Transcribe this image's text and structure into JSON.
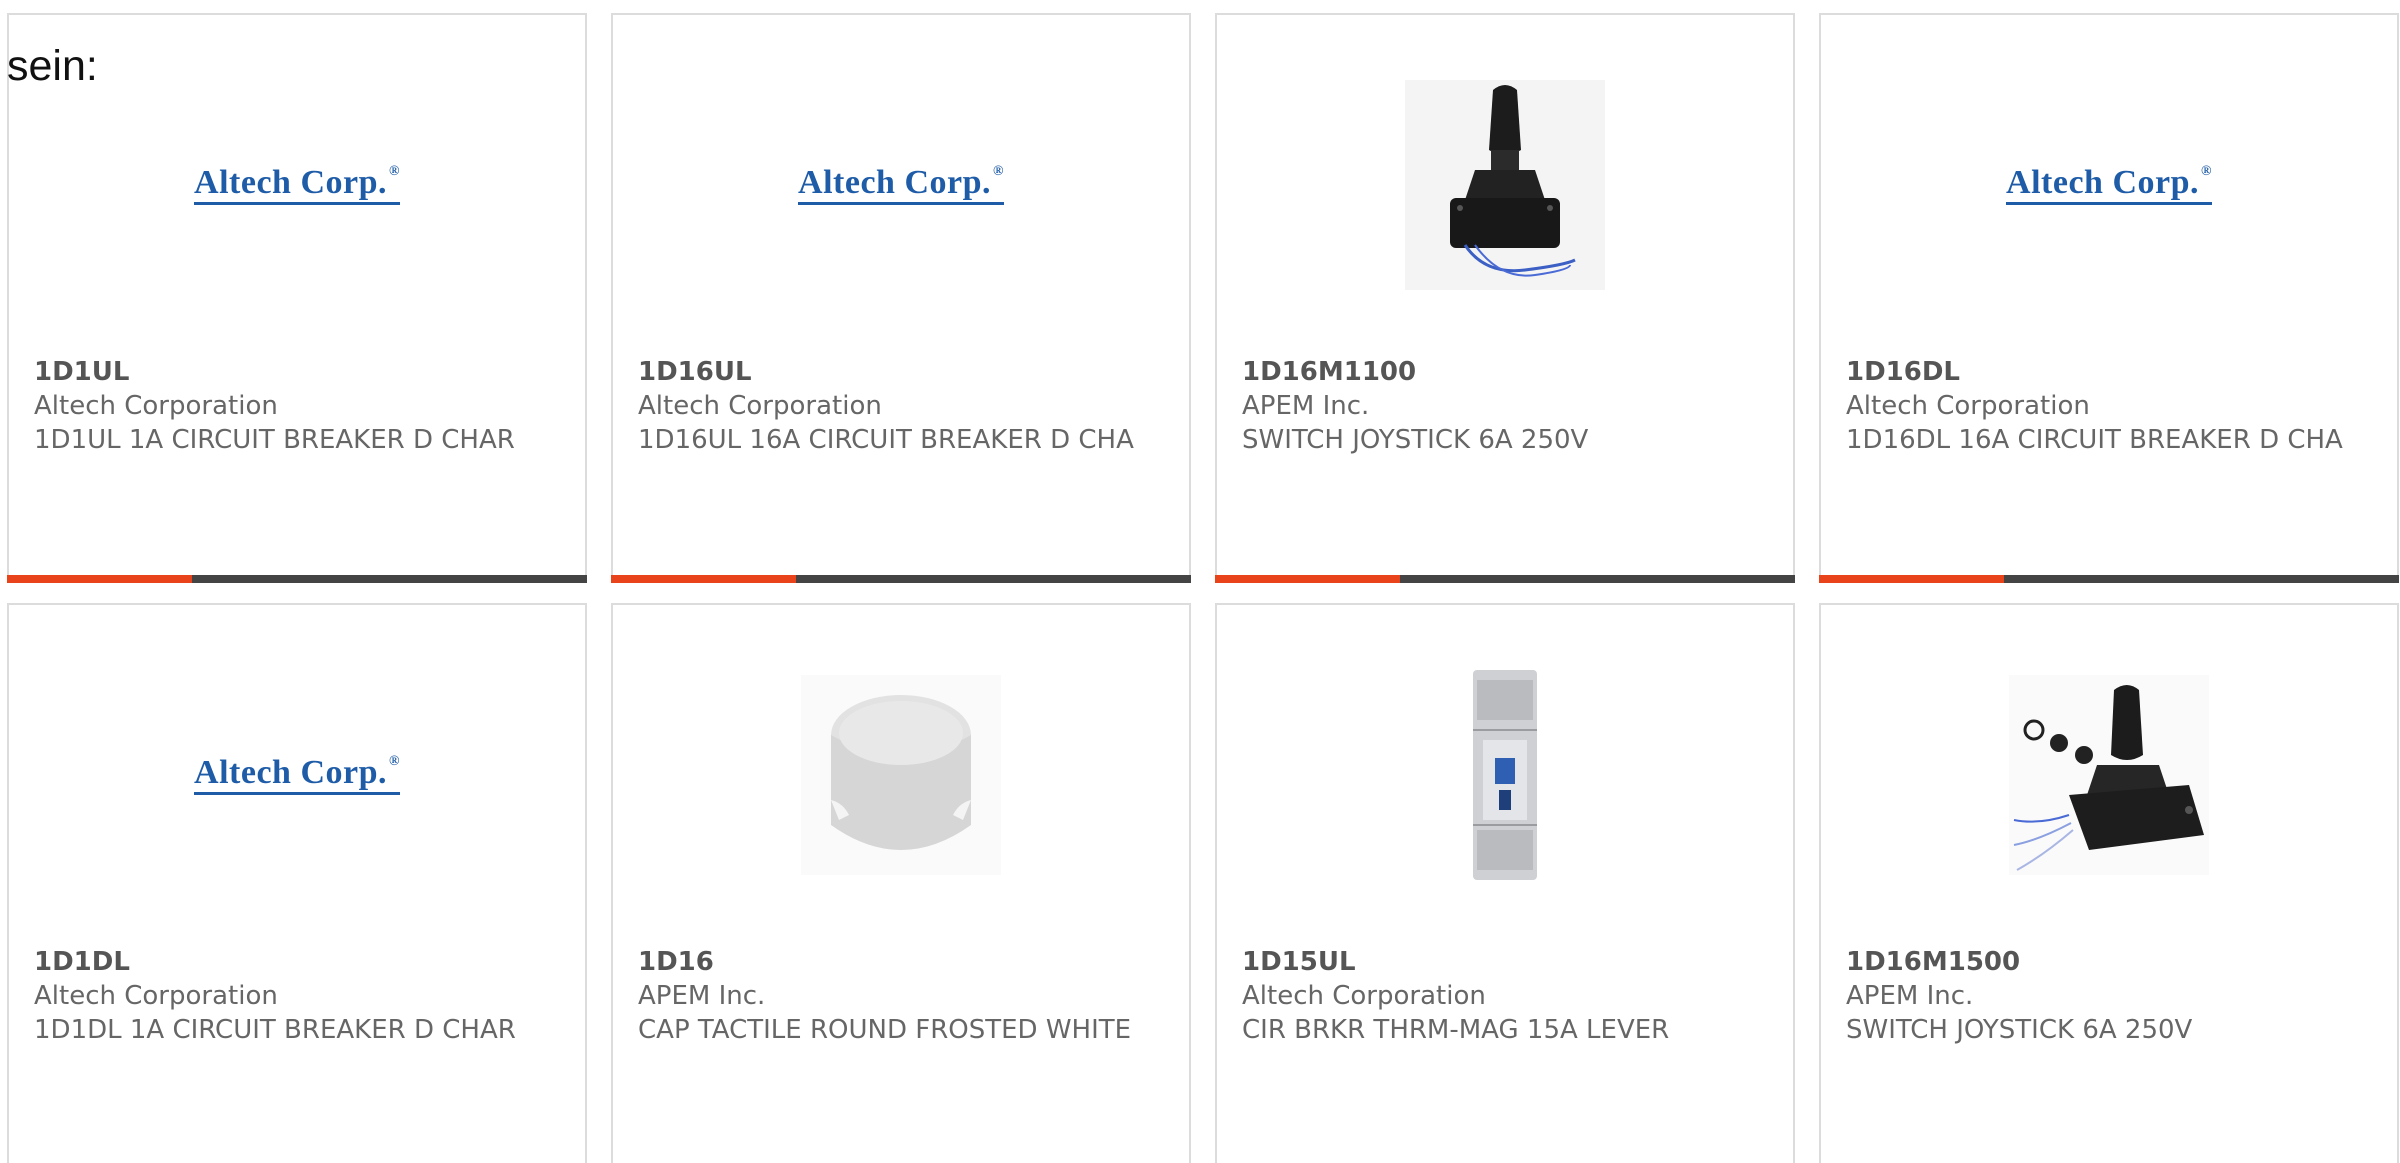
{
  "intro_text": "sein:",
  "logo": {
    "text": "Altech Corp.",
    "reg_mark": "®",
    "color": "#1f5ca8"
  },
  "accent_color": "#e8431b",
  "products": [
    {
      "part_no": "1D1UL",
      "manufacturer": "Altech Corporation",
      "description": "1D1UL 1A CIRCUIT BREAKER D CHAR",
      "image": "altech-logo"
    },
    {
      "part_no": "1D16UL",
      "manufacturer": "Altech Corporation",
      "description": "1D16UL 16A CIRCUIT BREAKER D CHA",
      "image": "altech-logo"
    },
    {
      "part_no": "1D16M1100",
      "manufacturer": "APEM Inc.",
      "description": "SWITCH JOYSTICK 6A 250V",
      "image": "joystick-photo"
    },
    {
      "part_no": "1D16DL",
      "manufacturer": "Altech Corporation",
      "description": "1D16DL 16A CIRCUIT BREAKER D CHA",
      "image": "altech-logo"
    },
    {
      "part_no": "1D1DL",
      "manufacturer": "Altech Corporation",
      "description": "1D1DL 1A CIRCUIT BREAKER D CHAR",
      "image": "altech-logo"
    },
    {
      "part_no": "1D16",
      "manufacturer": "APEM Inc.",
      "description": "CAP TACTILE ROUND FROSTED WHITE",
      "image": "round-cap-photo"
    },
    {
      "part_no": "1D15UL",
      "manufacturer": "Altech Corporation",
      "description": "CIR BRKR THRM-MAG 15A LEVER",
      "image": "circuit-breaker-photo"
    },
    {
      "part_no": "1D16M1500",
      "manufacturer": "APEM Inc.",
      "description": "SWITCH JOYSTICK 6A 250V",
      "image": "joystick-base-photo"
    }
  ]
}
